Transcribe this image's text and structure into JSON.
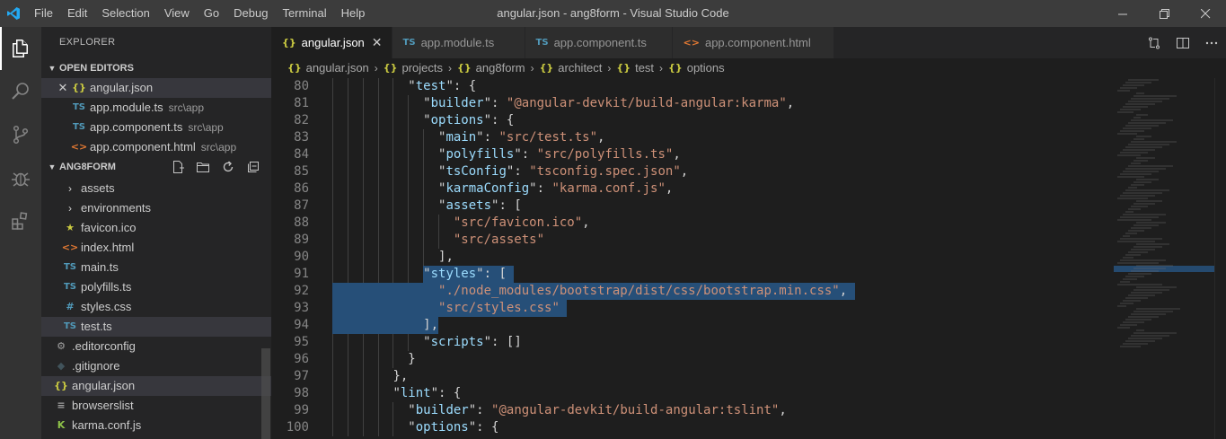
{
  "titlebar": {
    "menu": [
      "File",
      "Edit",
      "Selection",
      "View",
      "Go",
      "Debug",
      "Terminal",
      "Help"
    ],
    "title": "angular.json - ang8form - Visual Studio Code"
  },
  "activitybar": {
    "icons": [
      "explorer-icon",
      "search-icon",
      "source-control-icon",
      "debug-icon",
      "extensions-icon"
    ]
  },
  "sidebar": {
    "title": "EXPLORER",
    "open_editors": {
      "label": "OPEN EDITORS",
      "items": [
        {
          "icon": "{}",
          "name": "angular.json",
          "desc": ""
        },
        {
          "icon": "TS",
          "name": "app.module.ts",
          "desc": "src\\app"
        },
        {
          "icon": "TS",
          "name": "app.component.ts",
          "desc": "src\\app"
        },
        {
          "icon": "<>",
          "name": "app.component.html",
          "desc": "src\\app"
        }
      ]
    },
    "project": {
      "label": "ANG8FORM",
      "items": [
        {
          "type": "folder",
          "name": "assets"
        },
        {
          "type": "folder",
          "name": "environments"
        },
        {
          "type": "file",
          "icon": "★",
          "name": "favicon.ico"
        },
        {
          "type": "file",
          "icon": "<>",
          "name": "index.html"
        },
        {
          "type": "file",
          "icon": "TS",
          "name": "main.ts"
        },
        {
          "type": "file",
          "icon": "TS",
          "name": "polyfills.ts"
        },
        {
          "type": "file",
          "icon": "#",
          "name": "styles.css"
        },
        {
          "type": "file",
          "icon": "TS",
          "name": "test.ts"
        },
        {
          "type": "file",
          "icon": "⚙",
          "name": ".editorconfig"
        },
        {
          "type": "file",
          "icon": "◆",
          "name": ".gitignore"
        },
        {
          "type": "file",
          "icon": "{}",
          "name": "angular.json"
        },
        {
          "type": "file",
          "icon": "≡",
          "name": "browserslist"
        },
        {
          "type": "file",
          "icon": "K",
          "name": "karma.conf.js"
        }
      ]
    }
  },
  "tabs": [
    {
      "icon": "{}",
      "label": "angular.json",
      "active": true
    },
    {
      "icon": "TS",
      "label": "app.module.ts",
      "active": false
    },
    {
      "icon": "TS",
      "label": "app.component.ts",
      "active": false
    },
    {
      "icon": "<>",
      "label": "app.component.html",
      "active": false
    }
  ],
  "breadcrumb": {
    "file": "angular.json",
    "path": [
      "projects",
      "ang8form",
      "architect",
      "test",
      "options"
    ],
    "icon": "{}"
  },
  "code": {
    "lines": [
      {
        "n": "80",
        "t": [
          [
            "p",
            "\""
          ],
          [
            "k",
            "test"
          ],
          [
            "p",
            "\": {"
          ]
        ]
      },
      {
        "n": "81",
        "t": [
          [
            "p",
            "\""
          ],
          [
            "k",
            "builder"
          ],
          [
            "p",
            "\": "
          ],
          [
            "s",
            "\"@angular-devkit/build-angular:karma\""
          ],
          [
            "p",
            ","
          ]
        ]
      },
      {
        "n": "82",
        "t": [
          [
            "p",
            "\""
          ],
          [
            "k",
            "options"
          ],
          [
            "p",
            "\": {"
          ]
        ]
      },
      {
        "n": "83",
        "t": [
          [
            "p",
            "\""
          ],
          [
            "k",
            "main"
          ],
          [
            "p",
            "\": "
          ],
          [
            "s",
            "\"src/test.ts\""
          ],
          [
            "p",
            ","
          ]
        ]
      },
      {
        "n": "84",
        "t": [
          [
            "p",
            "\""
          ],
          [
            "k",
            "polyfills"
          ],
          [
            "p",
            "\": "
          ],
          [
            "s",
            "\"src/polyfills.ts\""
          ],
          [
            "p",
            ","
          ]
        ]
      },
      {
        "n": "85",
        "t": [
          [
            "p",
            "\""
          ],
          [
            "k",
            "tsConfig"
          ],
          [
            "p",
            "\": "
          ],
          [
            "s",
            "\"tsconfig.spec.json\""
          ],
          [
            "p",
            ","
          ]
        ]
      },
      {
        "n": "86",
        "t": [
          [
            "p",
            "\""
          ],
          [
            "k",
            "karmaConfig"
          ],
          [
            "p",
            "\": "
          ],
          [
            "s",
            "\"karma.conf.js\""
          ],
          [
            "p",
            ","
          ]
        ]
      },
      {
        "n": "87",
        "t": [
          [
            "p",
            "\""
          ],
          [
            "k",
            "assets"
          ],
          [
            "p",
            "\": ["
          ]
        ]
      },
      {
        "n": "88",
        "t": [
          [
            "s",
            "\"src/favicon.ico\""
          ],
          [
            "p",
            ","
          ]
        ]
      },
      {
        "n": "89",
        "t": [
          [
            "s",
            "\"src/assets\""
          ]
        ]
      },
      {
        "n": "90",
        "t": [
          [
            "p",
            "],"
          ]
        ]
      },
      {
        "n": "91",
        "t": [
          [
            "p",
            "\""
          ],
          [
            "k",
            "styles"
          ],
          [
            "p",
            "\": ["
          ]
        ]
      },
      {
        "n": "92",
        "t": [
          [
            "s",
            "\"./node_modules/bootstrap/dist/css/bootstrap.min.css\""
          ],
          [
            "p",
            ","
          ]
        ]
      },
      {
        "n": "93",
        "t": [
          [
            "s",
            "\"src/styles.css\""
          ]
        ]
      },
      {
        "n": "94",
        "t": [
          [
            "p",
            "],"
          ]
        ]
      },
      {
        "n": "95",
        "t": [
          [
            "p",
            "\""
          ],
          [
            "k",
            "scripts"
          ],
          [
            "p",
            "\": []"
          ]
        ]
      },
      {
        "n": "96",
        "t": [
          [
            "p",
            "}"
          ]
        ]
      },
      {
        "n": "97",
        "t": [
          [
            "p",
            "},"
          ]
        ]
      },
      {
        "n": "98",
        "t": [
          [
            "p",
            "\""
          ],
          [
            "k",
            "lint"
          ],
          [
            "p",
            "\": {"
          ]
        ]
      },
      {
        "n": "99",
        "t": [
          [
            "p",
            "\""
          ],
          [
            "k",
            "builder"
          ],
          [
            "p",
            "\": "
          ],
          [
            "s",
            "\"@angular-devkit/build-angular:tslint\""
          ],
          [
            "p",
            ","
          ]
        ]
      },
      {
        "n": "100",
        "t": [
          [
            "p",
            "\""
          ],
          [
            "k",
            "options"
          ],
          [
            "p",
            "\": {"
          ]
        ]
      }
    ]
  },
  "colors": {
    "accent": "#007acc",
    "selection": "#264f78",
    "json_icon": "#cbcb41",
    "ts_icon": "#519aba",
    "html_icon": "#e37933"
  }
}
